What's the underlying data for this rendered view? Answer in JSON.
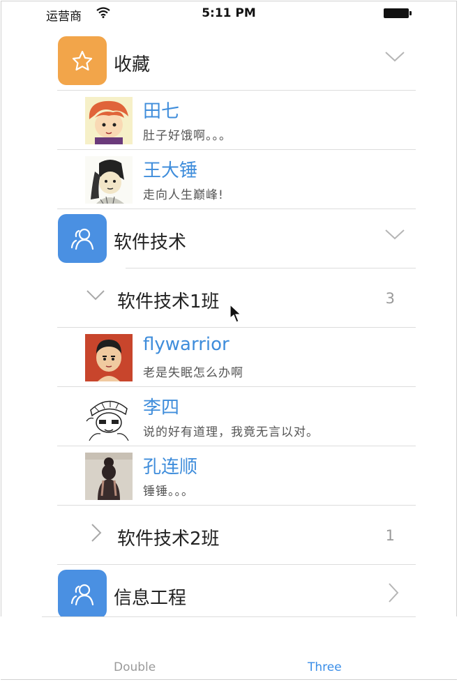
{
  "status_bar": {
    "carrier": "运营商",
    "time": "5:11 PM"
  },
  "sections": [
    {
      "title": "收藏",
      "icon": "star-icon",
      "color": "#f2a54a",
      "expanded": true,
      "friends": [
        {
          "name": "田七",
          "signature": "肚子好饿啊。。。"
        },
        {
          "name": "王大锤",
          "signature": "走向人生巅峰!"
        }
      ]
    },
    {
      "title": "软件技术",
      "icon": "group-icon",
      "color": "#4a90e2",
      "expanded": true,
      "groups": [
        {
          "title": "软件技术1班",
          "count": "3",
          "expanded": true,
          "friends": [
            {
              "name": "flywarrior",
              "signature": "老是失眠怎么办啊"
            },
            {
              "name": "李四",
              "signature": "说的好有道理，我竟无言以对。"
            },
            {
              "name": "孔连顺",
              "signature": "锤锤。。。"
            }
          ]
        },
        {
          "title": "软件技术2班",
          "count": "1",
          "expanded": false
        }
      ]
    },
    {
      "title": "信息工程",
      "icon": "group-icon",
      "color": "#4a90e2",
      "expanded": false
    }
  ],
  "tab_bar": {
    "tabs": [
      {
        "label": "Double",
        "selected": false
      },
      {
        "label": "Three",
        "selected": true
      }
    ],
    "accent": "#3a8ee8"
  }
}
